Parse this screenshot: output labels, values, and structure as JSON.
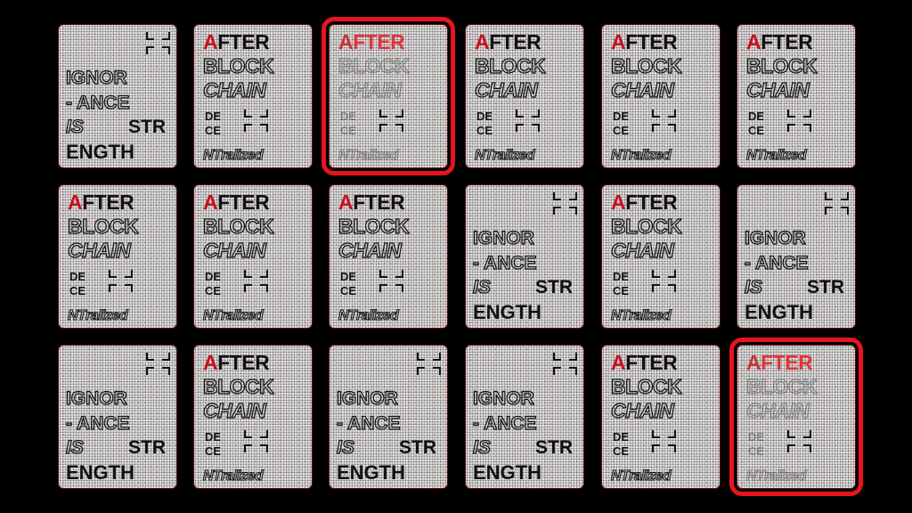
{
  "cards": [
    {
      "type": "ignorance",
      "selected": false
    },
    {
      "type": "after",
      "selected": false
    },
    {
      "type": "after",
      "selected": true,
      "faded": true
    },
    {
      "type": "after",
      "selected": false
    },
    {
      "type": "after",
      "selected": false
    },
    {
      "type": "after",
      "selected": false
    },
    {
      "type": "after",
      "selected": false
    },
    {
      "type": "after",
      "selected": false
    },
    {
      "type": "after",
      "selected": false
    },
    {
      "type": "ignorance",
      "selected": false
    },
    {
      "type": "after",
      "selected": false
    },
    {
      "type": "ignorance",
      "selected": false
    },
    {
      "type": "ignorance",
      "selected": false
    },
    {
      "type": "after",
      "selected": false
    },
    {
      "type": "ignorance",
      "selected": false
    },
    {
      "type": "ignorance",
      "selected": false
    },
    {
      "type": "after",
      "selected": false
    },
    {
      "type": "after",
      "selected": true,
      "faded": true
    }
  ],
  "after_card": {
    "line1_first": "A",
    "line1_rest": "FTER",
    "line2": "BLOCK",
    "line3": "CHAIN",
    "line4": "DE",
    "line5": "CE",
    "line6": "NTralized"
  },
  "ignorance_card": {
    "line1": "IGNOR",
    "line2": "- ANCE",
    "line3": "IS",
    "line3b": "STR",
    "line4": "ENGTH"
  },
  "colors": {
    "background": "#000000",
    "accent": "#e8141c",
    "card": "#d9d9d9",
    "ink": "#111111"
  }
}
